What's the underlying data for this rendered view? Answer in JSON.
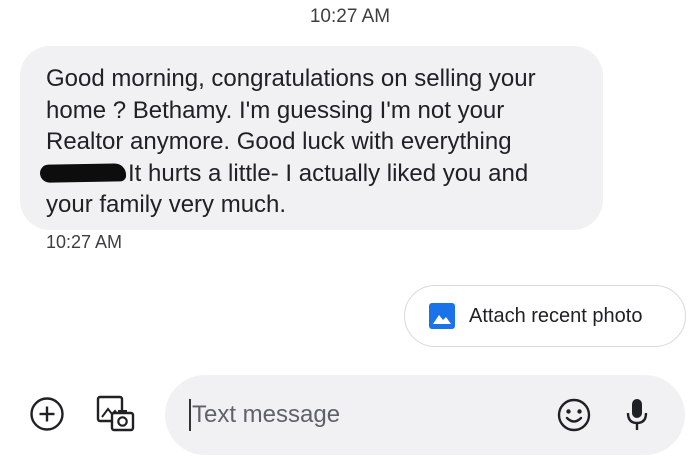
{
  "header": {
    "time": "10:27 AM"
  },
  "message": {
    "lines": [
      "Good morning, congratulations on selling your",
      "home ? Bethamy. I'm guessing I'm not your",
      "Realtor anymore. Good luck with everything",
      "It hurts a little- I actually liked you and",
      "your family very much."
    ],
    "time": "10:27 AM"
  },
  "suggestion": {
    "label": "Attach recent photo",
    "icon": "image-icon"
  },
  "composer": {
    "placeholder": "Text message",
    "left_icons": [
      "plus-circle-icon",
      "gallery-icon"
    ],
    "right_icons": [
      "emoji-icon",
      "microphone-icon"
    ]
  },
  "colors": {
    "bubble_bg": "#f1f1f3",
    "accent": "#1a73e8",
    "text": "#202124"
  }
}
